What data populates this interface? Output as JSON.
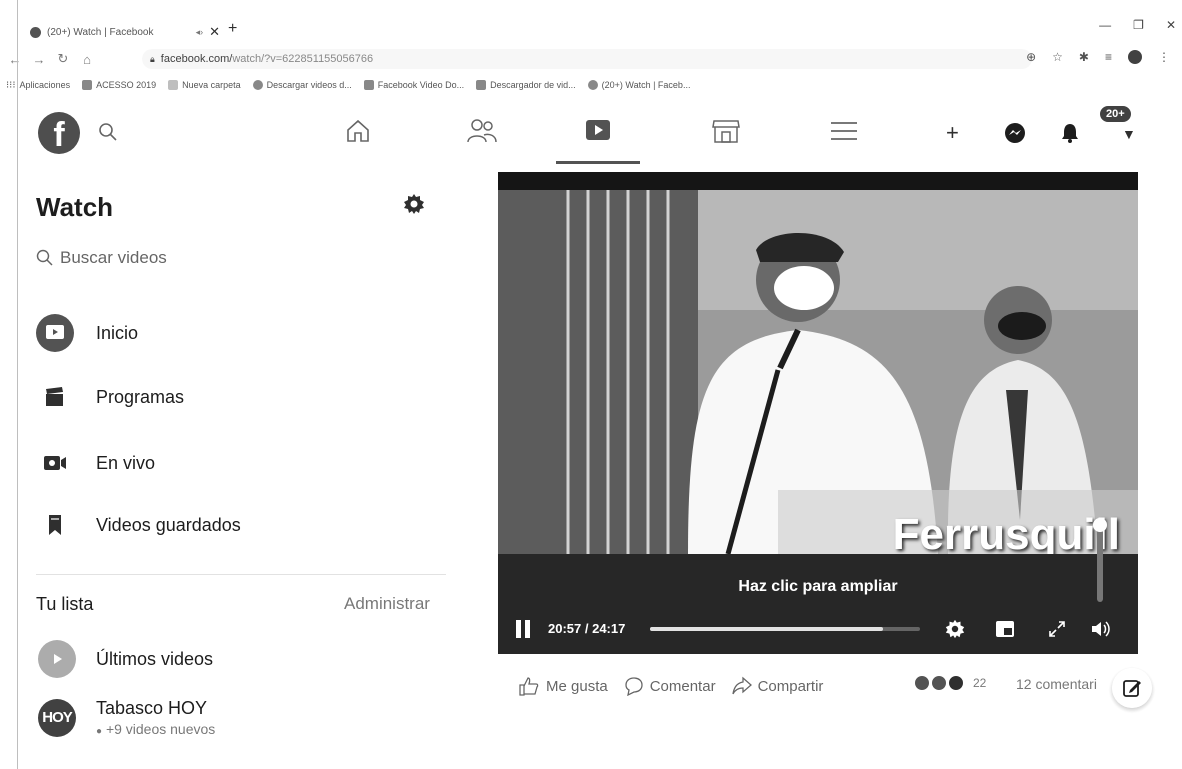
{
  "browser": {
    "tab_title": "(20+) Watch | Facebook",
    "url_host": "facebook.com/",
    "url_path": "watch/?v=622851155056766",
    "bookmarks": [
      {
        "label": "Aplicaciones"
      },
      {
        "label": "ACESSO 2019"
      },
      {
        "label": "Nueva carpeta"
      },
      {
        "label": "Descargar videos d..."
      },
      {
        "label": "Facebook Video Do..."
      },
      {
        "label": "Descargador de vid..."
      },
      {
        "label": "(20+) Watch | Faceb..."
      }
    ]
  },
  "fb_nav": {
    "logo_letter": "f",
    "notif_badge": "20+"
  },
  "sidebar": {
    "title": "Watch",
    "search_placeholder": "Buscar videos",
    "items": [
      {
        "label": "Inicio"
      },
      {
        "label": "Programas"
      },
      {
        "label": "En vivo"
      },
      {
        "label": "Videos guardados"
      }
    ],
    "list_title": "Tu lista",
    "manage_label": "Administrar",
    "list": [
      {
        "title": "Últimos videos"
      },
      {
        "title": "Tabasco HOY",
        "subtitle": "+9 videos nuevos",
        "avatar_text": "HOY"
      }
    ]
  },
  "player": {
    "overlay_caption": "Ferrusquill",
    "expand_label": "Haz clic para ampliar",
    "time_current": "20:57",
    "time_total": "24:17",
    "progress_fraction": 0.863
  },
  "actions": {
    "like": "Me gusta",
    "comment": "Comentar",
    "share": "Compartir",
    "reaction_count": "22",
    "comments_count": "12 comentari"
  }
}
